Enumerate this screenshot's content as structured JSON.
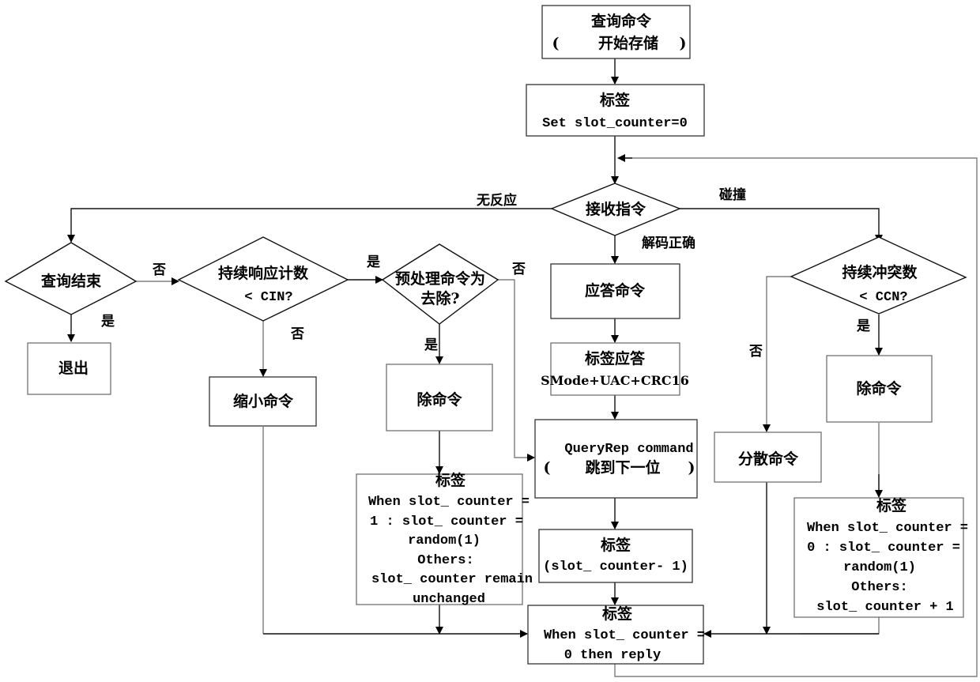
{
  "nodes": {
    "query_cmd": {
      "line1": "查询命令",
      "line2_open": "(",
      "line2": "开始存储",
      "line2_close": ")"
    },
    "tag_init": {
      "line1": "标签",
      "line2": "Set slot_counter=0"
    },
    "receive": {
      "label": "接收指令"
    },
    "query_end": {
      "label": "查询结束"
    },
    "exit": {
      "label": "退出"
    },
    "cont_resp": {
      "line1": "持续响应计数",
      "line2": "< CIN?"
    },
    "preproc": {
      "line1": "预处理命令为",
      "line2": "去除?"
    },
    "shrink": {
      "label": "缩小命令"
    },
    "remove_left": {
      "label": "除命令"
    },
    "ack_cmd": {
      "label": "应答命令"
    },
    "tag_ack": {
      "line1": "标签应答",
      "line2": "SMode+UAC+CRC16"
    },
    "queryrep": {
      "line1": "QueryRep command",
      "line2_open": "(",
      "line2": "跳到下一位",
      "line2_close": ")"
    },
    "tag_dec": {
      "line1": "标签",
      "line2": "(slot_ counter- 1)"
    },
    "tag_left": {
      "lines": [
        "标签",
        "When slot_ counter =",
        "1 : slot_ counter =",
        "random(1)",
        "Others:",
        "slot_  counter remain",
        "unchanged"
      ]
    },
    "tag_reply": {
      "lines": [
        "标签",
        "When slot_ counter =",
        "0 then reply"
      ]
    },
    "cont_conflict": {
      "line1": "持续冲突数",
      "line2": "< CCN?"
    },
    "remove_right": {
      "label": "除命令"
    },
    "scatter": {
      "label": "分散命令"
    },
    "tag_right": {
      "lines": [
        "标签",
        "When slot_ counter =",
        "0 : slot_ counter =",
        "random(1)",
        "Others:",
        "slot_ counter + 1"
      ]
    }
  },
  "edge_labels": {
    "no_response": "无反应",
    "collision": "碰撞",
    "decoded_ok": "解码正确",
    "query_end_no": "否",
    "query_end_yes": "是",
    "cont_resp_yes": "是",
    "cont_resp_no": "否",
    "preproc_no": "否",
    "preproc_yes": "是",
    "conflict_no": "否",
    "conflict_yes": "是"
  }
}
